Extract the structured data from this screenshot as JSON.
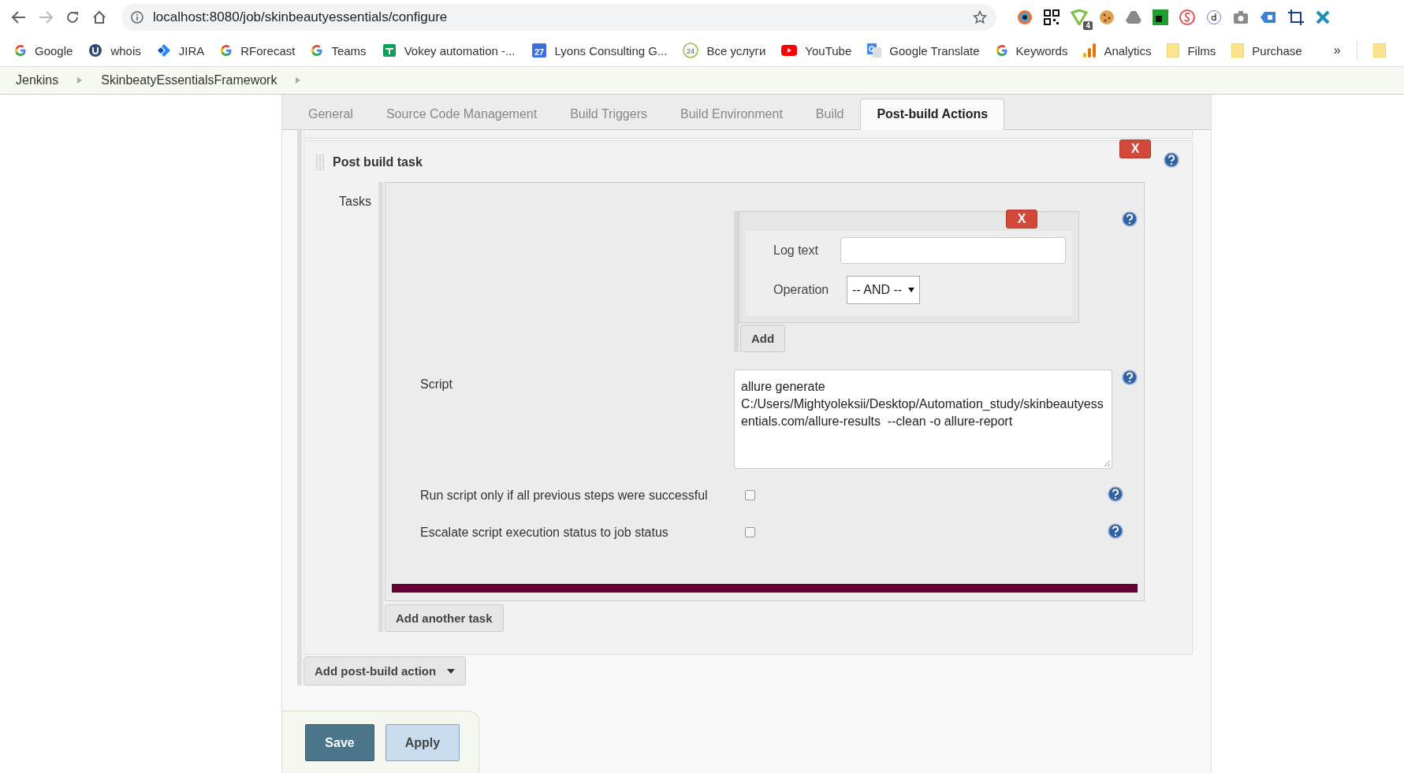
{
  "browser": {
    "url": "localhost:8080/job/skinbeautyessentials/configure",
    "extension_badge": "4"
  },
  "bookmarks": [
    {
      "label": "Google"
    },
    {
      "label": "whois"
    },
    {
      "label": "JIRA"
    },
    {
      "label": "RForecast"
    },
    {
      "label": "Teams"
    },
    {
      "label": "Vokey automation -..."
    },
    {
      "label": "Lyons Consulting G..."
    },
    {
      "label": "Все услуги"
    },
    {
      "label": "YouTube"
    },
    {
      "label": "Google Translate"
    },
    {
      "label": "Keywords"
    },
    {
      "label": "Analytics"
    },
    {
      "label": "Films"
    },
    {
      "label": "Purchase"
    }
  ],
  "calendar_day": "27",
  "ring_number": "24",
  "bookmarks_overflow": "»",
  "breadcrumbs": [
    "Jenkins",
    "SkinbeatyEssentialsFramework"
  ],
  "tabs": [
    {
      "label": "General",
      "selected": false
    },
    {
      "label": "Source Code Management",
      "selected": false
    },
    {
      "label": "Build Triggers",
      "selected": false
    },
    {
      "label": "Build Environment",
      "selected": false
    },
    {
      "label": "Build",
      "selected": false
    },
    {
      "label": "Post-build Actions",
      "selected": true
    }
  ],
  "post_build_task": {
    "title": "Post build task",
    "delete": "X",
    "tasks_label": "Tasks",
    "log_entry": {
      "delete": "X",
      "log_text_label": "Log text",
      "operation_label": "Operation",
      "operation_value": "-- AND --"
    },
    "add_button": "Add",
    "script_label": "Script",
    "script_value": "allure generate C:/Users/Mightyoleksii/Desktop/Automation_study/skinbeautyessentials.com/allure-results  --clean -o allure-report",
    "options": [
      {
        "label": "Run script only if all previous steps were successful",
        "checked": false
      },
      {
        "label": "Escalate script execution status to job status",
        "checked": false
      }
    ],
    "add_task_button": "Add another task"
  },
  "add_post_build_action": "Add post-build action",
  "buttons": [
    {
      "label": "Save",
      "kind": "primary"
    },
    {
      "label": "Apply",
      "kind": "secondary"
    }
  ]
}
